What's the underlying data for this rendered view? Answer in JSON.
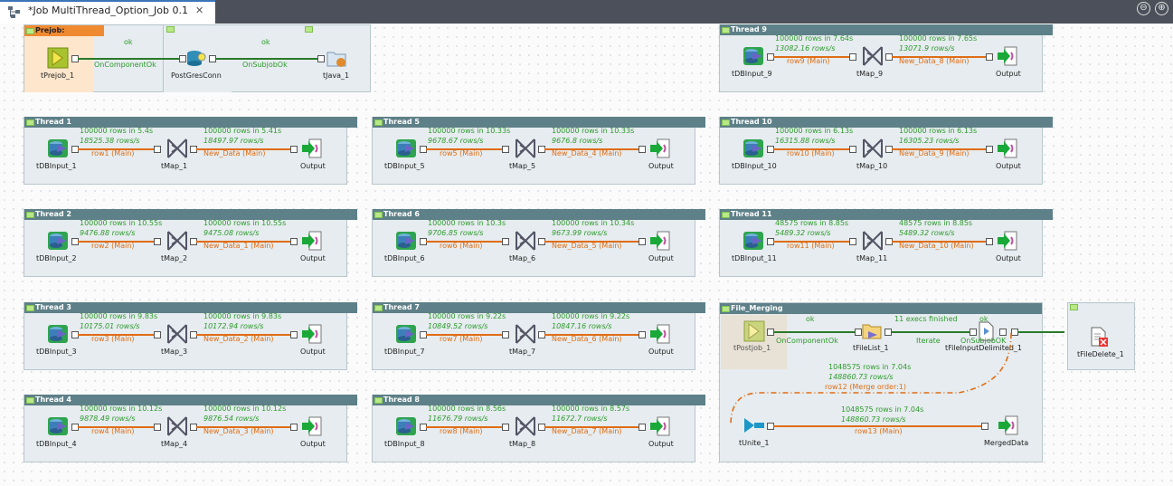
{
  "tab": {
    "title": "*Job MultiThread_Option_Job 0.1",
    "close": "✕"
  },
  "window": {
    "min": "⊖",
    "max": "⊕"
  },
  "prejob": {
    "title": "Prejob:",
    "tprejob": "tPrejob_1",
    "postgres": "PostGresConn",
    "tjava": "tJava_1",
    "ok1": "ok",
    "on_component_ok": "OnComponentOk",
    "ok2": "ok",
    "on_subjob_ok": "OnSubjobOk"
  },
  "threads": [
    {
      "title": "Thread 1",
      "input": "tDBInput_1",
      "map": "tMap_1",
      "output": "Output",
      "stat_in": "100000 rows in 5.4s",
      "rate_in": "18525.38 rows/s",
      "row": "row1 (Main)",
      "stat_out": "100000 rows in 5.41s",
      "rate_out": "18497.97 rows/s",
      "out_row": "New_Data (Main)"
    },
    {
      "title": "Thread 2",
      "input": "tDBInput_2",
      "map": "tMap_2",
      "output": "Output",
      "stat_in": "100000 rows in 10.55s",
      "rate_in": "9476.88 rows/s",
      "row": "row2 (Main)",
      "stat_out": "100000 rows in 10.55s",
      "rate_out": "9475.08 rows/s",
      "out_row": "New_Data_1 (Main)"
    },
    {
      "title": "Thread 3",
      "input": "tDBInput_3",
      "map": "tMap_3",
      "output": "Output",
      "stat_in": "100000 rows in 9.83s",
      "rate_in": "10175.01 rows/s",
      "row": "row3 (Main)",
      "stat_out": "100000 rows in 9.83s",
      "rate_out": "10172.94 rows/s",
      "out_row": "New_Data_2 (Main)"
    },
    {
      "title": "Thread 4",
      "input": "tDBInput_4",
      "map": "tMap_4",
      "output": "Output",
      "stat_in": "100000 rows in 10.12s",
      "rate_in": "9878.49 rows/s",
      "row": "row4 (Main)",
      "stat_out": "100000 rows in 10.12s",
      "rate_out": "9876.54 rows/s",
      "out_row": "New_Data_3 (Main)"
    },
    {
      "title": "Thread 5",
      "input": "tDBInput_5",
      "map": "tMap_5",
      "output": "Output",
      "stat_in": "100000 rows in 10.33s",
      "rate_in": "9678.67 rows/s",
      "row": "row5 (Main)",
      "stat_out": "100000 rows in 10.33s",
      "rate_out": "9676.8 rows/s",
      "out_row": "New_Data_4 (Main)"
    },
    {
      "title": "Thread 6",
      "input": "tDBInput_6",
      "map": "tMap_6",
      "output": "Output",
      "stat_in": "100000 rows in 10.3s",
      "rate_in": "9706.85 rows/s",
      "row": "row6 (Main)",
      "stat_out": "100000 rows in 10.34s",
      "rate_out": "9673.99 rows/s",
      "out_row": "New_Data_5 (Main)"
    },
    {
      "title": "Thread 7",
      "input": "tDBInput_7",
      "map": "tMap_7",
      "output": "Output",
      "stat_in": "100000 rows in 9.22s",
      "rate_in": "10849.52 rows/s",
      "row": "row7 (Main)",
      "stat_out": "100000 rows in 9.22s",
      "rate_out": "10847.16 rows/s",
      "out_row": "New_Data_6 (Main)"
    },
    {
      "title": "Thread 8",
      "input": "tDBInput_8",
      "map": "tMap_8",
      "output": "Output",
      "stat_in": "100000 rows in 8.56s",
      "rate_in": "11676.79 rows/s",
      "row": "row8 (Main)",
      "stat_out": "100000 rows in 8.57s",
      "rate_out": "11672.7 rows/s",
      "out_row": "New_Data_7 (Main)"
    },
    {
      "title": "Thread 9",
      "input": "tDBInput_9",
      "map": "tMap_9",
      "output": "Output",
      "stat_in": "100000 rows in 7.64s",
      "rate_in": "13082.16 rows/s",
      "row": "row9 (Main)",
      "stat_out": "100000 rows in 7.65s",
      "rate_out": "13071.9 rows/s",
      "out_row": "New_Data_8 (Main)"
    },
    {
      "title": "Thread 10",
      "input": "tDBInput_10",
      "map": "tMap_10",
      "output": "Output",
      "stat_in": "100000 rows in 6.13s",
      "rate_in": "16315.88 rows/s",
      "row": "row10 (Main)",
      "stat_out": "100000 rows in 6.13s",
      "rate_out": "16305.23 rows/s",
      "out_row": "New_Data_9 (Main)"
    },
    {
      "title": "Thread 11",
      "input": "tDBInput_11",
      "map": "tMap_11",
      "output": "Output",
      "stat_in": "48575 rows in 8.85s",
      "rate_in": "5489.32 rows/s",
      "row": "row11 (Main)",
      "stat_out": "48575 rows in 8.85s",
      "rate_out": "5489.32 rows/s",
      "out_row": "New_Data_10 (Main)"
    }
  ],
  "merging": {
    "title": "File_Merging",
    "postjob": "tPostjob_1",
    "filelist": "tFileList_1",
    "delimited": "tFileInputDelimited_1",
    "unite": "tUnite_1",
    "merged": "MergedData",
    "delete": "tFileDelete_1",
    "ok1": "ok",
    "on_component_ok": "OnComponentOk",
    "execs": "11 execs finished",
    "iterate": "Iterate",
    "ok2": "ok",
    "on_subjob_ok": "OnSubjobOK",
    "stat_merge": "1048575 rows in 7.04s",
    "rate_merge": "148860.73 rows/s",
    "row_merge": "row12 (Merge order:1)",
    "stat_out": "1048575 rows in 7.04s",
    "rate_out": "148860.73 rows/s",
    "row_out": "row13 (Main)"
  }
}
